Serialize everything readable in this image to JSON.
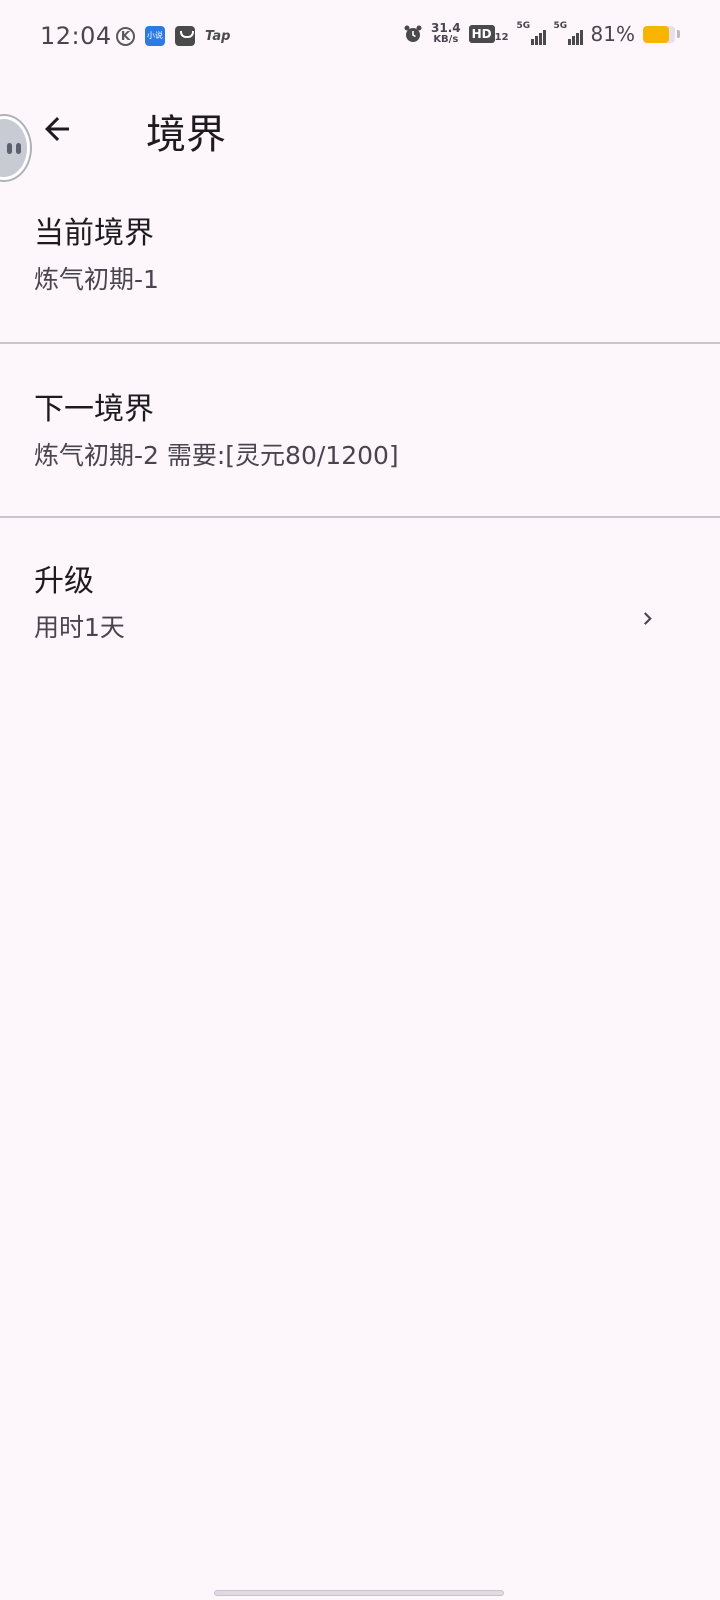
{
  "status_bar": {
    "time": "12:04",
    "k_icon": "K",
    "blue_app_text": "小说",
    "tap_label": "Tap",
    "speed_value": "31.4",
    "speed_unit": "KB/s",
    "hd_label": "HD",
    "hd_sub": "12",
    "signal_1_label": "5G",
    "signal_2_label": "5G",
    "battery_text": "81%",
    "battery_level": 0.81,
    "battery_color": "#f9b400"
  },
  "app_bar": {
    "back_icon": "arrow-left-icon",
    "title": "境界"
  },
  "list": {
    "items": [
      {
        "title": "当前境界",
        "subtitle": "炼气初期-1"
      },
      {
        "title": "下一境界",
        "subtitle": "炼气初期-2 需要:[灵元80/1200]"
      },
      {
        "title": "升级",
        "subtitle": "用时1天",
        "trailing_icon": "chevron-right-icon"
      }
    ]
  },
  "colors": {
    "background": "#fdf7fc",
    "primary_text": "#1d1b20",
    "secondary_text": "#49454f",
    "divider": "#cac4d0"
  }
}
